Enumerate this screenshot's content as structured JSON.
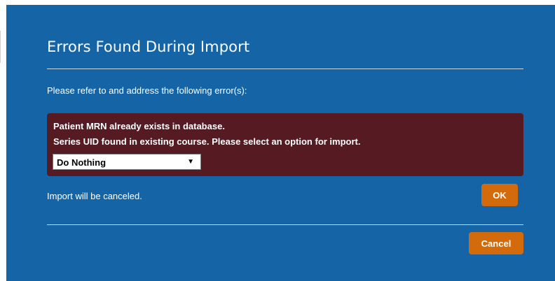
{
  "dialog": {
    "title": "Errors Found During Import",
    "instruction": "Please refer to and address the following error(s):",
    "errors": [
      "Patient MRN already exists in database.",
      "Series UID found in existing course. Please select an option for import."
    ],
    "import_option": {
      "selected": "Do Nothing",
      "icon": "chevron-down-icon"
    },
    "status_message": "Import will be canceled.",
    "ok_label": "OK",
    "cancel_label": "Cancel"
  },
  "colors": {
    "dialog_bg": "#1565a6",
    "error_bg": "#561a22",
    "button_bg": "#d36a0b"
  }
}
